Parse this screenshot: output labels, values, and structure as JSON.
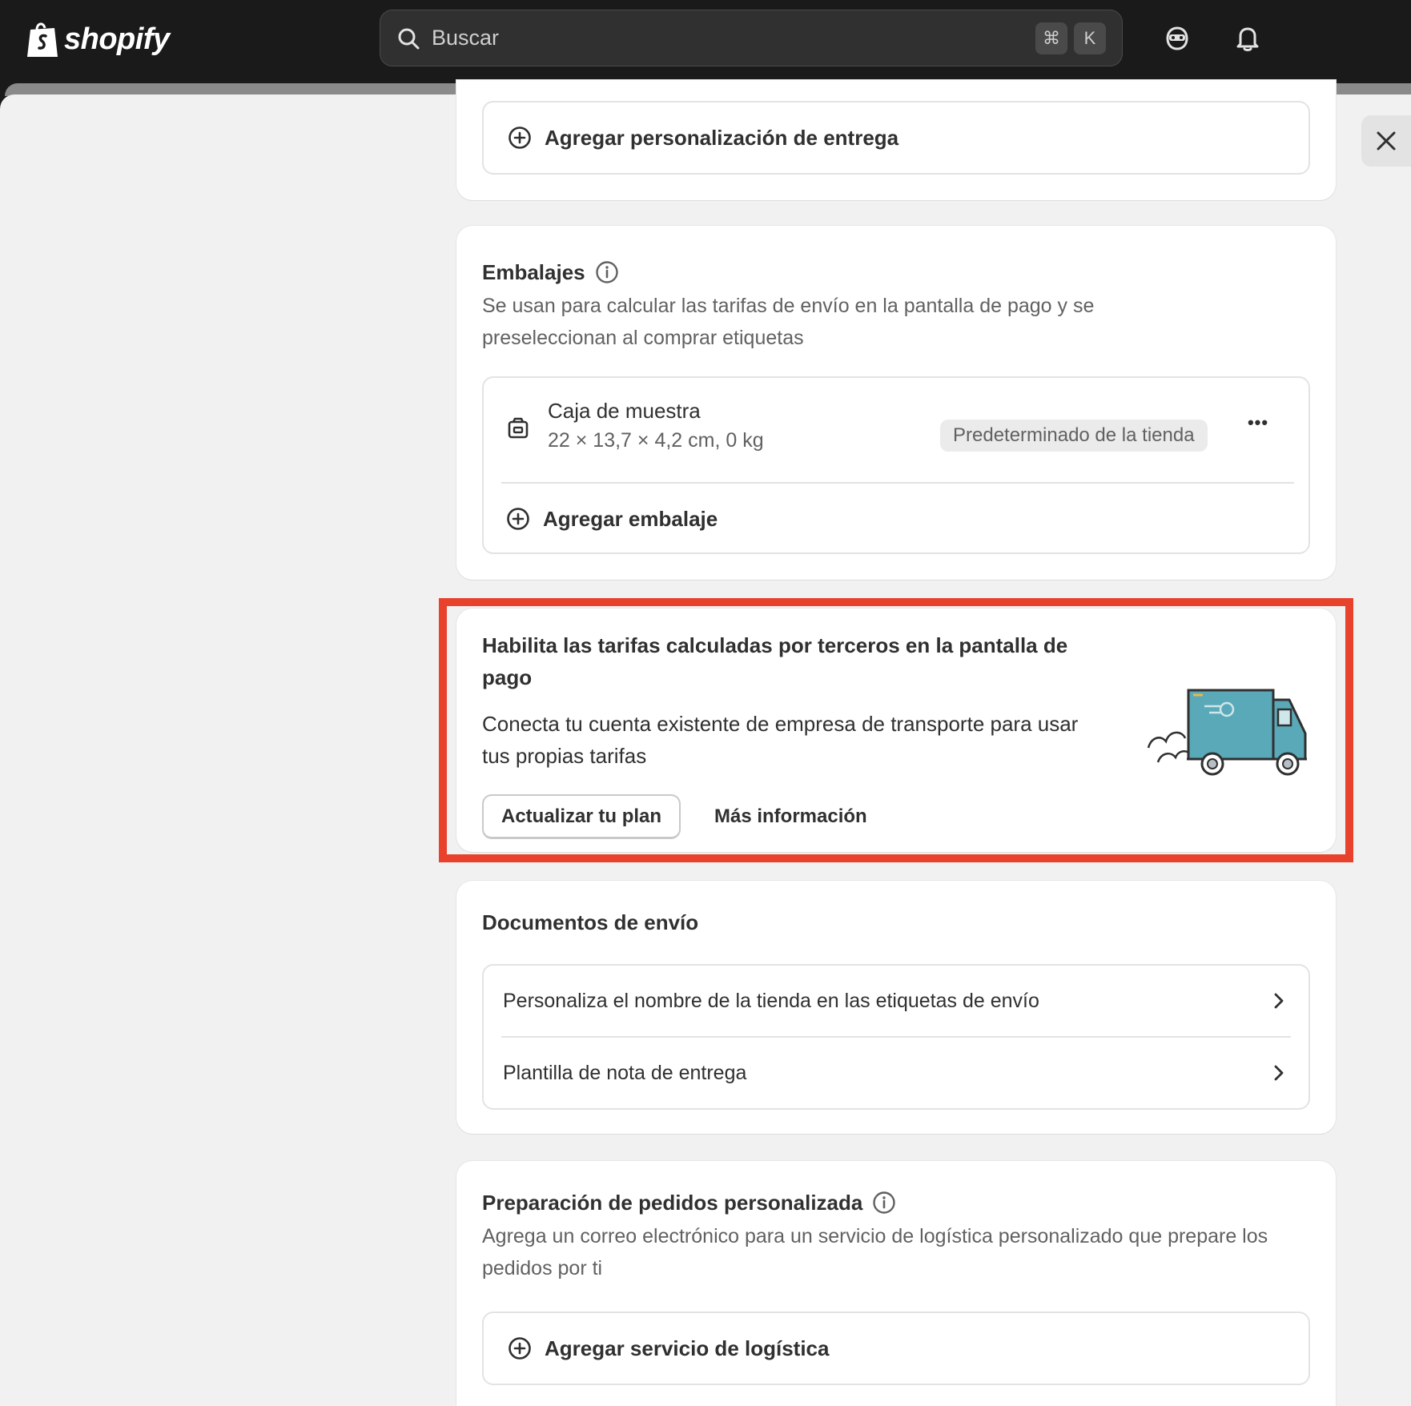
{
  "topbar": {
    "brand": "shopify",
    "search_placeholder": "Buscar",
    "shortcut_cmd": "⌘",
    "shortcut_key": "K"
  },
  "delivery_custom": {
    "add_label": "Agregar personalización de entrega"
  },
  "packages": {
    "title": "Embalajes",
    "description": "Se usan para calcular las tarifas de envío en la pantalla de pago y se preseleccionan al comprar etiquetas",
    "item_name": "Caja de muestra",
    "item_dims": "22 × 13,7 × 4,2 cm, 0 kg",
    "item_badge": "Predeterminado de la tienda",
    "more_actions": "•••",
    "add_label": "Agregar embalaje"
  },
  "carrier_promo": {
    "title": "Habilita las tarifas calculadas por terceros en la pantalla de pago",
    "description": "Conecta tu cuenta existente de empresa de transporte para usar tus propias tarifas",
    "upgrade_label": "Actualizar tu plan",
    "learn_more_label": "Más información"
  },
  "shipping_docs": {
    "title": "Documentos de envío",
    "items": [
      {
        "label": "Personaliza el nombre de la tienda en las etiquetas de envío"
      },
      {
        "label": "Plantilla de nota de entrega"
      }
    ]
  },
  "custom_fulfillment": {
    "title": "Preparación de pedidos personalizada",
    "description": "Agrega un correo electrónico para un servicio de logística personalizado que prepare los pedidos por ti",
    "add_label": "Agregar servicio de logística"
  },
  "colors": {
    "topbar": "#1a1a1a",
    "page_bg": "#f1f1f1",
    "highlight": "#e8412c",
    "truck": "#5aa9b8"
  }
}
